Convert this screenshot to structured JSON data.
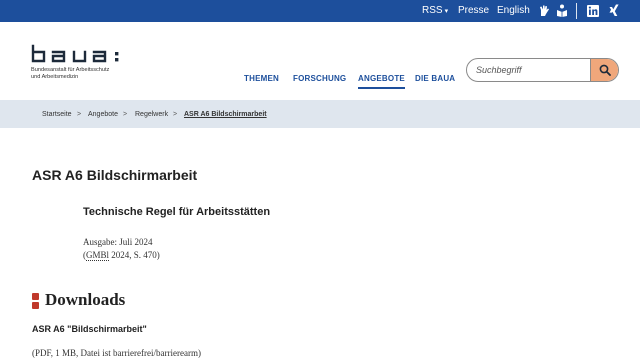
{
  "topbar": {
    "rss": "RSS",
    "presse": "Presse",
    "english": "English",
    "icons": [
      "sign-language-icon",
      "easy-language-icon",
      "linkedin-icon",
      "xing-icon"
    ]
  },
  "header": {
    "logo_text": "baua:",
    "logo_sub_line1": "Bundesanstalt für Arbeitsschutz",
    "logo_sub_line2": "und Arbeitsmedizin",
    "nav": [
      "THEMEN",
      "FORSCHUNG",
      "ANGEBOTE",
      "DIE BAUA"
    ],
    "active_nav": "ANGEBOTE",
    "search_placeholder": "Suchbegriff"
  },
  "breadcrumb": {
    "items": [
      "Startseite",
      "Angebote",
      "Regelwerk",
      "ASR A6 Bildschirmarbeit"
    ],
    "separator": ">"
  },
  "main": {
    "title": "ASR A6 Bildschirmarbeit",
    "subtitle": "Technische Regel für Arbeitsstätten",
    "issue": "Ausgabe: Juli 2024",
    "source_open": "(",
    "source_abbr": "GMBl",
    "source_rest": " 2024, S. 470)",
    "downloads_heading": "Downloads",
    "file_title": "ASR A6 \"Bildschirmarbeit\"",
    "file_meta": "(PDF, 1 MB, Datei ist barrierefrei/barrierearm)"
  },
  "colors": {
    "brand_blue": "#1d4f9c",
    "breadcrumb_bg": "#dfe6ee",
    "search_button": "#f0a77b",
    "marker_red": "#c0392b"
  }
}
